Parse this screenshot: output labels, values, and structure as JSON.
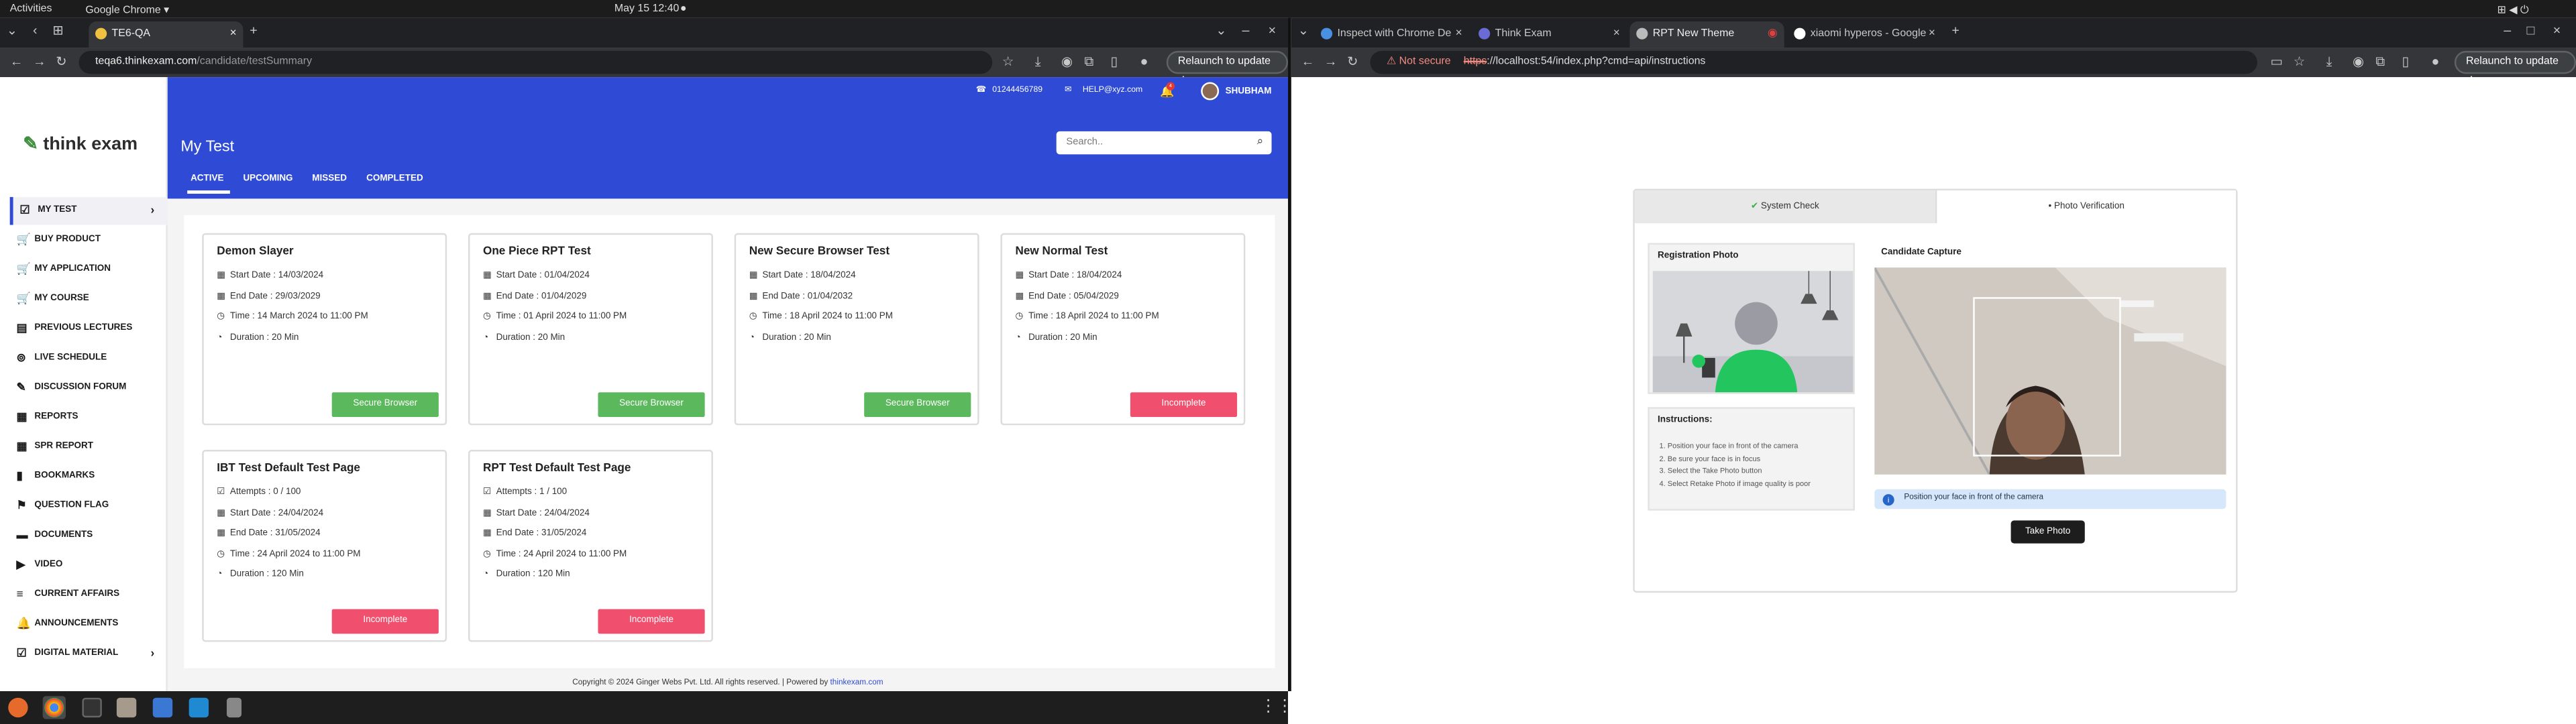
{
  "os": {
    "activities": "Activities",
    "app_menu": "Google Chrome ▾",
    "clock": "May 15  12:40",
    "clock_dot": "●"
  },
  "left_browser": {
    "tab_title": "TE6-QA",
    "url_host": "teqa6.thinkexam.com",
    "url_path": "/candidate/testSummary",
    "relaunch": "Relaunch to update ⋮"
  },
  "right_browser": {
    "tabs": [
      "Inspect with Chrome De",
      "Think Exam",
      "RPT New Theme",
      "xiaomi hyperos - Google"
    ],
    "not_secure": "Not secure",
    "url_scheme": "https",
    "url_rest": "://localhost:54/index.php?cmd=api/instructions",
    "relaunch": "Relaunch to update ⋮"
  },
  "app": {
    "logo_main": "think exam",
    "phone": "01244456789",
    "email": "HELP@xyz.com",
    "bell_count": "4",
    "user": "SHUBHAM",
    "page_title": "My Test",
    "search_placeholder": "Search..",
    "tabs": [
      "ACTIVE",
      "UPCOMING",
      "MISSED",
      "COMPLETED"
    ],
    "sidebar": [
      {
        "label": "MY TEST",
        "icon": "checkbox-icon"
      },
      {
        "label": "BUY PRODUCT",
        "icon": "cart-icon"
      },
      {
        "label": "MY APPLICATION",
        "icon": "cart-icon"
      },
      {
        "label": "MY COURSE",
        "icon": "cart-icon"
      },
      {
        "label": "PREVIOUS LECTURES",
        "icon": "document-icon"
      },
      {
        "label": "LIVE SCHEDULE",
        "icon": "live-icon"
      },
      {
        "label": "DISCUSSION FORUM",
        "icon": "forum-icon"
      },
      {
        "label": "REPORTS",
        "icon": "report-icon"
      },
      {
        "label": "SPR REPORT",
        "icon": "report-icon"
      },
      {
        "label": "BOOKMARKS",
        "icon": "bookmark-icon"
      },
      {
        "label": "QUESTION FLAG",
        "icon": "flag-icon"
      },
      {
        "label": "DOCUMENTS",
        "icon": "folder-icon"
      },
      {
        "label": "VIDEO",
        "icon": "play-icon"
      },
      {
        "label": "CURRENT AFFAIRS",
        "icon": "list-icon"
      },
      {
        "label": "ANNOUNCEMENTS",
        "icon": "bell-icon"
      },
      {
        "label": "DIGITAL MATERIAL",
        "icon": "checkbox-icon"
      }
    ],
    "cards": [
      {
        "title": "Demon Slayer",
        "rows": [
          "Start Date : 14/03/2024",
          "End Date : 29/03/2029",
          "Time : 14 March 2024 to 11:00 PM",
          "Duration : 20 Min"
        ],
        "button": "Secure Browser",
        "button_color": "#5cb85c"
      },
      {
        "title": "One Piece RPT Test",
        "rows": [
          "Start Date : 01/04/2024",
          "End Date : 01/04/2029",
          "Time : 01 April 2024 to 11:00 PM",
          "Duration : 20 Min"
        ],
        "button": "Secure Browser",
        "button_color": "#5cb85c"
      },
      {
        "title": "New Secure Browser Test",
        "rows": [
          "Start Date : 18/04/2024",
          "End Date : 01/04/2032",
          "Time : 18 April 2024 to 11:00 PM",
          "Duration : 20 Min"
        ],
        "button": "Secure Browser",
        "button_color": "#5cb85c"
      },
      {
        "title": "New Normal Test",
        "rows": [
          "Start Date : 18/04/2024",
          "End Date : 05/04/2029",
          "Time : 18 April 2024 to 11:00 PM",
          "Duration : 20 Min"
        ],
        "button": "Incomplete",
        "button_color": "#f0506e"
      },
      {
        "title": "IBT Test Default Test Page",
        "rows": [
          "Attempts : 0 / 100",
          "Start Date : 24/04/2024",
          "End Date : 31/05/2024",
          "Time : 24 April 2024 to 11:00 PM",
          "Duration : 120 Min"
        ],
        "button": "Incomplete",
        "button_color": "#f0506e"
      },
      {
        "title": "RPT Test Default Test Page",
        "rows": [
          "Attempts : 1 / 100",
          "Start Date : 24/04/2024",
          "End Date : 31/05/2024",
          "Time : 24 April 2024 to 11:00 PM",
          "Duration : 120 Min"
        ],
        "button": "Incomplete",
        "button_color": "#f0506e"
      }
    ],
    "footer_text": "Copyright © 2024 Ginger Webs Pvt. Ltd. All rights reserved.   |   Powered by ",
    "footer_link": "thinkexam.com"
  },
  "verify": {
    "tab_system": "System Check",
    "tab_photo": "Photo Verification",
    "registration_title": "Registration Photo",
    "capture_title": "Candidate Capture",
    "instructions_title": "Instructions:",
    "instructions": [
      "1. Position your face in front of the camera",
      "2. Be sure your face is in focus",
      "3. Select the Take Photo button",
      "4. Select Retake Photo if image quality is poor"
    ],
    "info": "Position your face in front of the camera",
    "take_photo": "Take Photo"
  },
  "colors": {
    "brand_blue": "#2f4bd6",
    "green": "#5cb85c",
    "red": "#f0506e"
  }
}
